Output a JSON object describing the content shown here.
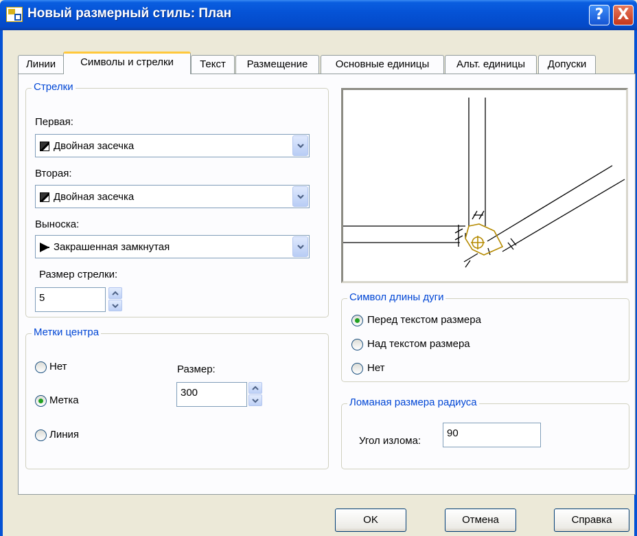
{
  "window": {
    "title": "Новый размерный стиль: План",
    "help_glyph": "?",
    "close_glyph": "X"
  },
  "tabs": [
    {
      "label": "Линии"
    },
    {
      "label": "Символы и стрелки"
    },
    {
      "label": "Текст"
    },
    {
      "label": "Размещение"
    },
    {
      "label": "Основные единицы"
    },
    {
      "label": "Альт. единицы"
    },
    {
      "label": "Допуски"
    }
  ],
  "arrows": {
    "group_title": "Стрелки",
    "first_label": "Первая:",
    "first_value": "Двойная засечка",
    "second_label": "Вторая:",
    "second_value": "Двойная засечка",
    "leader_label": "Выноска:",
    "leader_value": "Закрашенная замкнутая",
    "size_label": "Размер стрелки:",
    "size_value": "5"
  },
  "center_marks": {
    "group_title": "Метки центра",
    "options": [
      {
        "label": "Нет",
        "checked": false
      },
      {
        "label": "Метка",
        "checked": true
      },
      {
        "label": "Линия",
        "checked": false
      }
    ],
    "size_label": "Размер:",
    "size_value": "300"
  },
  "arc_length": {
    "group_title": "Символ длины дуги",
    "options": [
      {
        "label": "Перед текстом размера",
        "checked": true
      },
      {
        "label": "Над текстом размера",
        "checked": false
      },
      {
        "label": "Нет",
        "checked": false
      }
    ]
  },
  "radius_jog": {
    "group_title": "Ломаная размера радиуса",
    "angle_label": "Угол излома:",
    "angle_value": "90"
  },
  "buttons": {
    "ok": "OK",
    "cancel": "Отмена",
    "help": "Справка"
  },
  "colors": {
    "title_bar": "#0553d6",
    "group_title": "#0046d5",
    "active_tab_accent": "#ffc83c",
    "preview_accent": "#b58a00"
  }
}
